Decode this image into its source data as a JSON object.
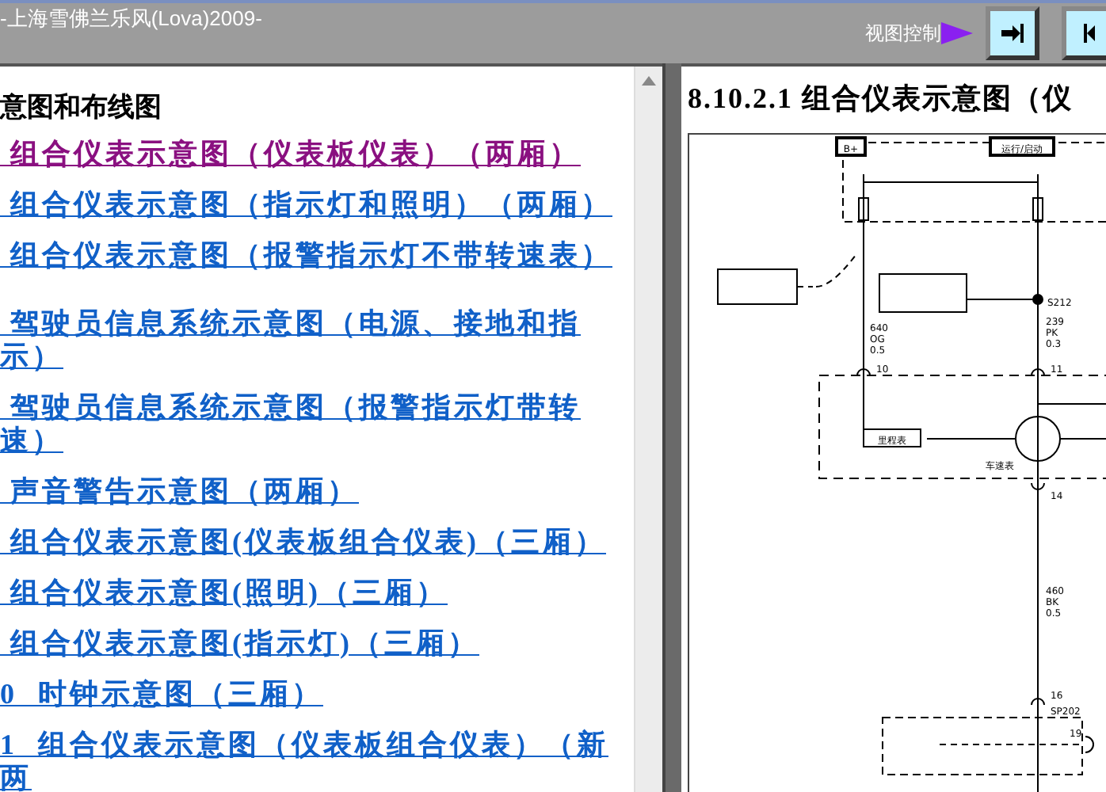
{
  "title_bar": {
    "title": "-上海雪佛兰乐风(Lova)2009-",
    "view_control_label": "视图控制"
  },
  "toc": {
    "heading": "意图和布线图",
    "groups": [
      {
        "items": [
          {
            "text": " 组合仪表示意图（仪表板仪表）（两厢）",
            "visited": true
          },
          {
            "text": " 组合仪表示意图（指示灯和照明）（两厢）",
            "visited": false
          },
          {
            "text": " 组合仪表示意图（报警指示灯不带转速表）",
            "visited": false
          }
        ]
      },
      {
        "items": [
          {
            "text": " 驾驶员信息系统示意图（电源、接地和指示）",
            "visited": false
          },
          {
            "text": " 驾驶员信息系统示意图（报警指示灯带转速）",
            "visited": false
          },
          {
            "text": " 声音警告示意图（两厢）",
            "visited": false
          },
          {
            "text": " 组合仪表示意图(仪表板组合仪表)（三厢）",
            "visited": false
          },
          {
            "text": " 组合仪表示意图(照明)（三厢）",
            "visited": false
          },
          {
            "text": " 组合仪表示意图(指示灯)（三厢）",
            "visited": false
          },
          {
            "text": "0  时钟示意图（三厢）",
            "visited": false
          },
          {
            "text": "1  组合仪表示意图（仪表板组合仪表）（新两",
            "visited": false
          }
        ]
      }
    ]
  },
  "document": {
    "heading": "8.10.2.1 组合仪表示意图（仪",
    "diagram_labels": {
      "battery": "B+",
      "run_start": "运行/启动",
      "speedometer": "车速表",
      "odometer": "里程表",
      "splice_1": "S212",
      "splice_2": "SP202",
      "wire_1": "640 OG 0.5",
      "wire_2": "239 PK 0.3",
      "wire_3": "460 BK 0.5",
      "pin_1": "10",
      "pin_2": "11",
      "pin_3": "14",
      "pin_4": "16",
      "pin_5": "19"
    }
  }
}
